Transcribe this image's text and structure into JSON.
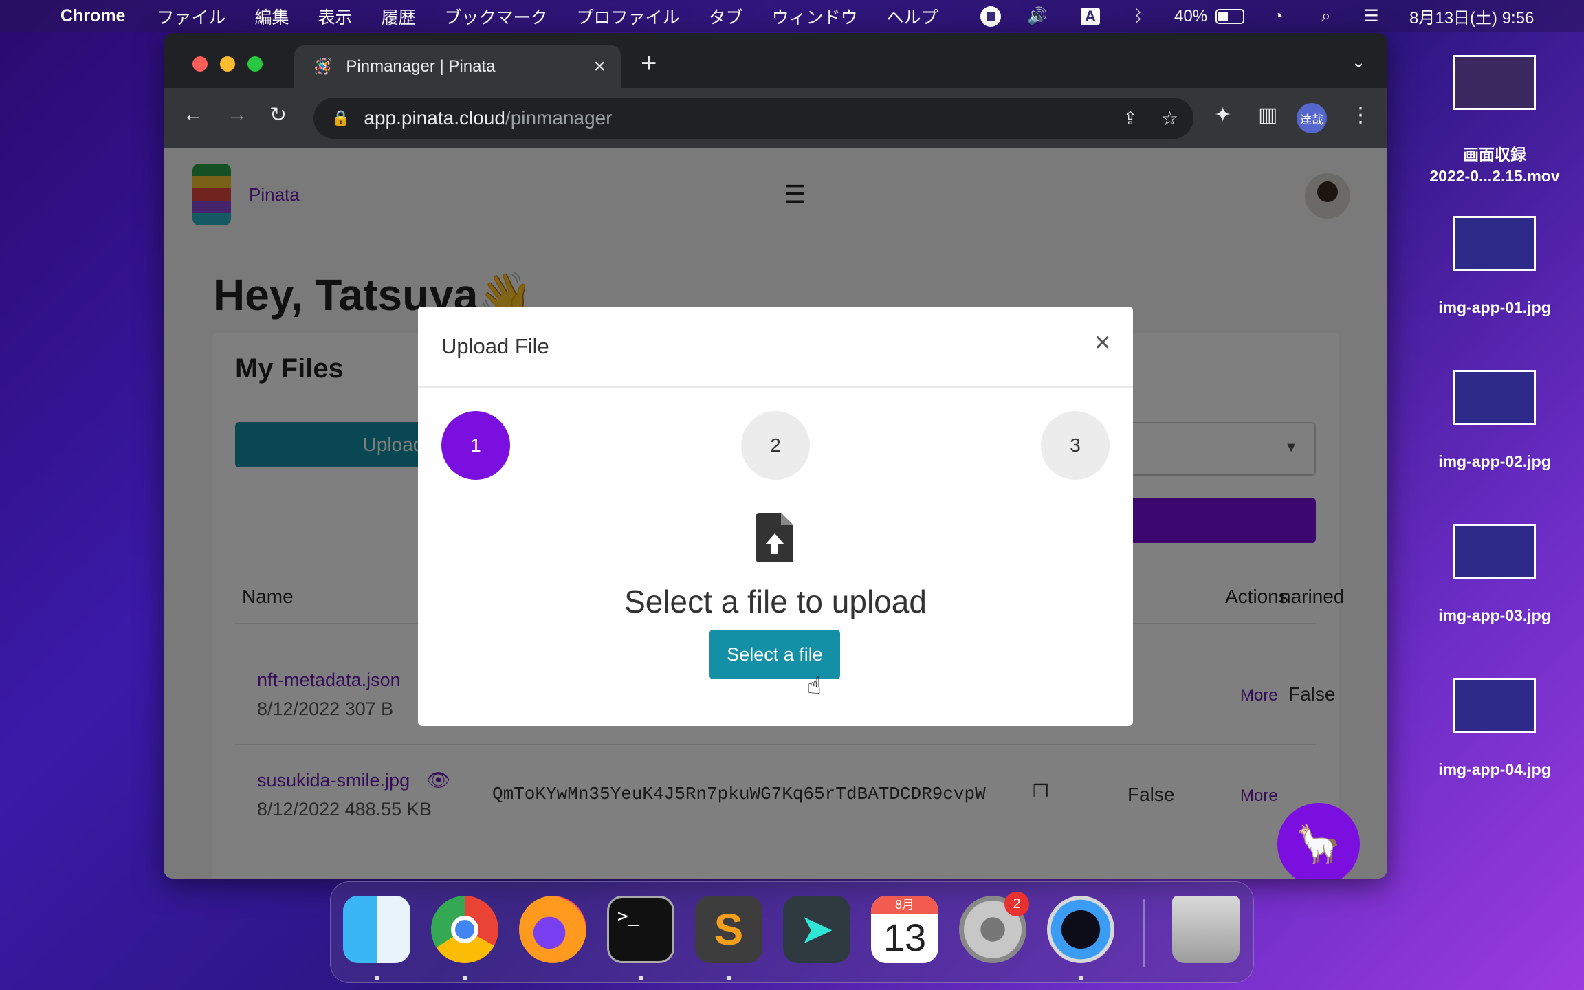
{
  "menubar": {
    "app": "Chrome",
    "items": [
      "ファイル",
      "編集",
      "表示",
      "履歴",
      "ブックマーク",
      "プロファイル",
      "タブ",
      "ウィンドウ",
      "ヘルプ"
    ],
    "status": {
      "input": "A",
      "battery": "40%",
      "clock": "8月13日(土) 9:56"
    }
  },
  "browser": {
    "tab_title": "Pinmanager | Pinata",
    "url_domain": "app.pinata.cloud",
    "url_path": "/pinmanager",
    "profile": "達哉"
  },
  "pinata": {
    "brand": "Pinata",
    "greeting": "Hey, Tatsuya",
    "files_heading": "My Files",
    "upload_button": "Upload",
    "columns": {
      "name": "Name",
      "pinned": "narined",
      "actions": "Actions"
    },
    "rows": [
      {
        "name": "nft-metadata.json",
        "meta": "8/12/2022 307 B",
        "cid": "",
        "pinned": "False",
        "action": "More"
      },
      {
        "name": "susukida-smile.jpg",
        "meta": "8/12/2022 488.55 KB",
        "cid": "QmToKYwMn35YeuK4J5Rn7pkuWG7Kq65rTdBATDCDR9cvpW",
        "pinned": "False",
        "action": "More"
      }
    ]
  },
  "modal": {
    "title": "Upload File",
    "close": "×",
    "steps": [
      "1",
      "2",
      "3"
    ],
    "prompt": "Select a file to upload",
    "button": "Select a file"
  },
  "desktop": [
    {
      "label": "画面収録\n2022-0...2.15.mov"
    },
    {
      "label": "img-app-01.jpg"
    },
    {
      "label": "img-app-02.jpg"
    },
    {
      "label": "img-app-03.jpg"
    },
    {
      "label": "img-app-04.jpg"
    }
  ],
  "dock": {
    "calendar_month": "8月",
    "calendar_day": "13",
    "settings_badge": "2"
  },
  "colors": {
    "accent_purple": "#7b0fe0",
    "button_teal": "#138fa6",
    "link_purple": "#6a1bb0"
  }
}
